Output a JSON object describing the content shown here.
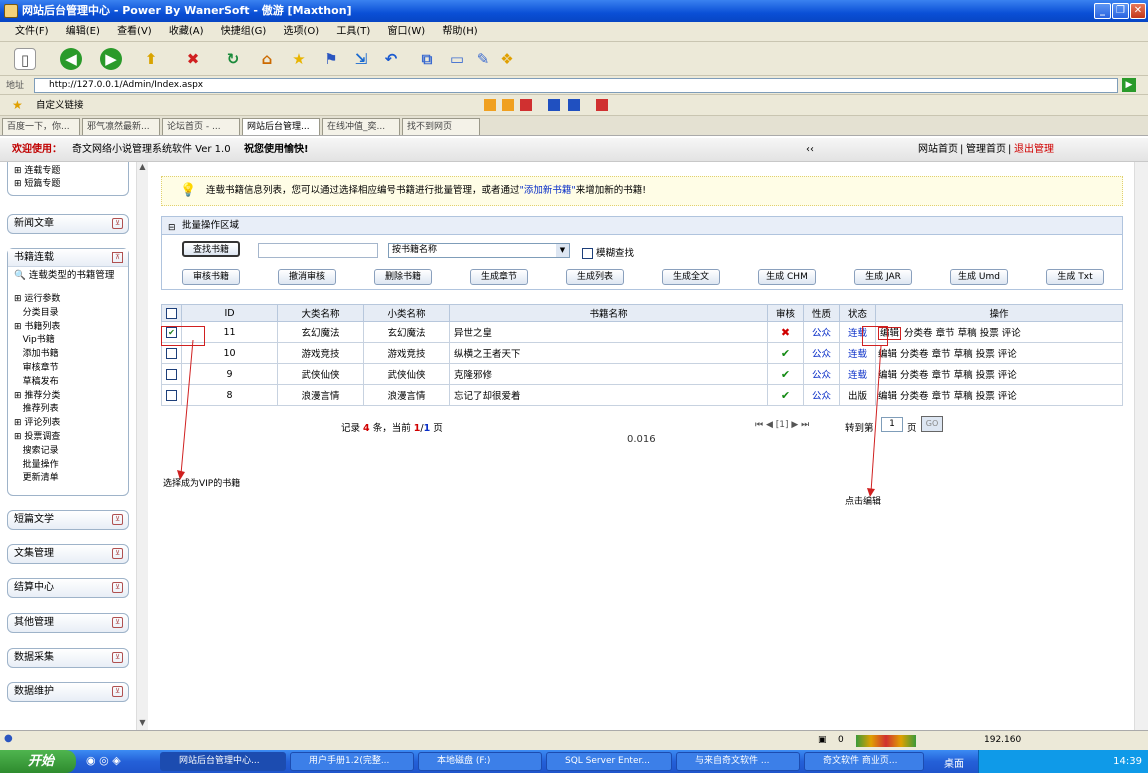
{
  "window": {
    "title": "网站后台管理中心 - Power By WanerSoft - 傲游 [Maxthon]"
  },
  "menu": [
    "文件(F)",
    "编辑(E)",
    "查看(V)",
    "收藏(A)",
    "快捷组(G)",
    "选项(O)",
    "工具(T)",
    "窗口(W)",
    "帮助(H)"
  ],
  "address": {
    "label": "地址",
    "url": "http://127.0.0.1/Admin/Index.aspx"
  },
  "favbar": {
    "label": "自定义链接"
  },
  "browser_tabs": [
    "百度一下，你...",
    "邪气凛然最新...",
    "论坛首页 - ...",
    "网站后台管理...",
    "在线冲值_奕...",
    "找不到网页"
  ],
  "header": {
    "welcome": "欢迎使用：",
    "software": "奇文网络小说管理系统软件 Ver 1.0",
    "wish": "祝您使用愉快!",
    "collapse": "‹‹",
    "links": {
      "home": "网站首页",
      "admin_home": "管理首页",
      "logout": "退出管理"
    }
  },
  "sidebar": {
    "top_items": [
      "连载专题",
      "短篇专题"
    ],
    "news": "新闻文章",
    "books": "书籍连载",
    "books_sub": "连载类型的书籍管理",
    "tree": [
      "运行参数",
      "分类目录",
      "书籍列表",
      "Vip书籍",
      "添加书籍",
      "审核章节",
      "草稿发布",
      "推荐分类",
      "推荐列表",
      "评论列表",
      "投票调查",
      "搜索记录",
      "批量操作",
      "更新清单"
    ],
    "sections": [
      "短篇文学",
      "文集管理",
      "结算中心",
      "其他管理",
      "数据采集",
      "数据维护"
    ]
  },
  "tip": {
    "text1": "连载书籍信息列表，您可以通过选择相应编号书籍进行批量管理，或者通过",
    "link": "\"添加新书籍\"",
    "text2": "来增加新的书籍!"
  },
  "batch": {
    "title": "批量操作区域",
    "find_btn": "查找书籍",
    "search_value": "",
    "select": "按书籍名称",
    "fuzzy": "模糊查找",
    "buttons": [
      "审核书籍",
      "撤消审核",
      "删除书籍",
      "生成章节",
      "生成列表",
      "生成全文",
      "生成 CHM",
      "生成 JAR",
      "生成 Umd",
      "生成 Txt"
    ]
  },
  "table": {
    "headers": [
      "ID",
      "大类名称",
      "小类名称",
      "书籍名称",
      "审核",
      "性质",
      "状态",
      "操作"
    ],
    "rows": [
      {
        "id": "11",
        "cat": "玄幻魔法",
        "sub": "玄幻魔法",
        "name": "异世之皇",
        "audit": "✖",
        "nature": "公众",
        "status": "连载",
        "checked": true
      },
      {
        "id": "10",
        "cat": "游戏竞技",
        "sub": "游戏竞技",
        "name": "纵横之王者天下",
        "audit": "✔",
        "nature": "公众",
        "status": "连载",
        "checked": false
      },
      {
        "id": "9",
        "cat": "武侠仙侠",
        "sub": "武侠仙侠",
        "name": "克隆邪修",
        "audit": "✔",
        "nature": "公众",
        "status": "连载",
        "checked": false
      },
      {
        "id": "8",
        "cat": "浪漫言情",
        "sub": "浪漫言情",
        "name": "忘记了却很爱着",
        "audit": "✔",
        "nature": "公众",
        "status": "出版",
        "checked": false
      }
    ],
    "ops": [
      "编辑",
      "分类卷",
      "章节",
      "草稿",
      "投票",
      "评论"
    ]
  },
  "pager": {
    "records_pre": "记录",
    "count": "4",
    "records_mid": "条，当前",
    "page": "1",
    "slash": "/",
    "total": "1",
    "page_unit": "页",
    "time": "0.016",
    "nav": "⏮ ◀ [1] ▶ ⏭",
    "goto": "转到第",
    "goto_value": "1",
    "goto_unit": "页",
    "go": "GO"
  },
  "annotations": {
    "vip": "选择成为VIP的书籍",
    "edit": "点击编辑"
  },
  "status": {
    "zero": "0",
    "ip": "192.160"
  },
  "taskbar": {
    "start": "开始",
    "tasks": [
      "网站后台管理中心...",
      "用户手册1.2(完整...",
      "本地磁盘 (F:)",
      "SQL Server Enter...",
      "与来自奇文软件 ...",
      "奇文软件 商业页..."
    ],
    "desktop": "桌面",
    "clock": "14:39"
  }
}
